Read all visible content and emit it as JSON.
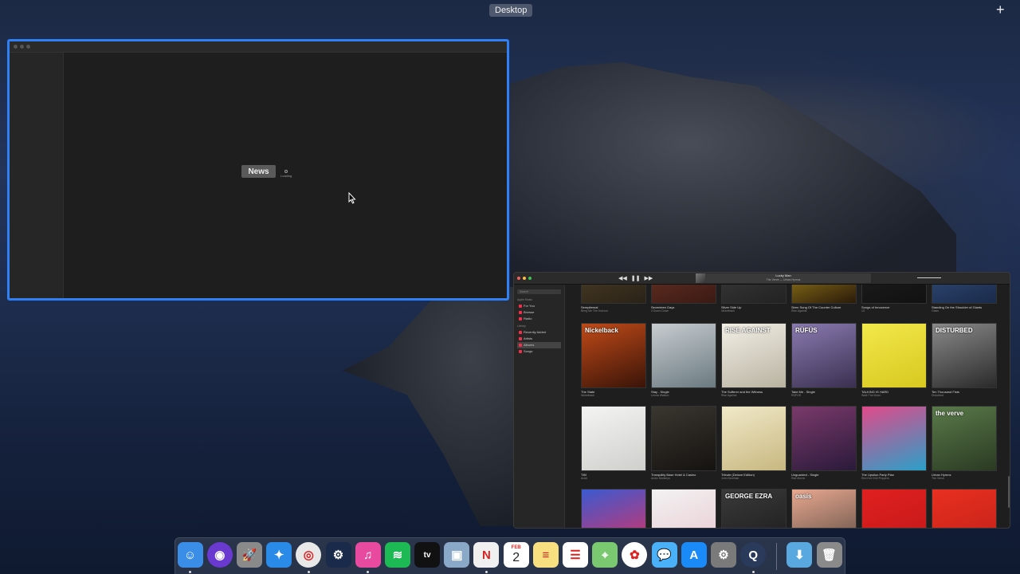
{
  "desktop": {
    "space_label": "Desktop",
    "add_space": "+"
  },
  "news_window": {
    "button_label": "News",
    "status": "Loading"
  },
  "music_window": {
    "now_playing": {
      "title": "Lucky Man",
      "subtitle": "The Verve — Urban Hymns"
    },
    "transport": {
      "prev": "◀◀",
      "play": "❚❚",
      "next": "▶▶"
    },
    "sidebar": {
      "search_placeholder": "Search",
      "section_apple_music": "Apple Music",
      "apple_music_items": [
        "For You",
        "Browse",
        "Radio"
      ],
      "section_library": "Library",
      "library_items": [
        "Recently Added",
        "Artists",
        "Albums",
        "Songs"
      ],
      "selected": "Albums"
    },
    "albums_row1": [
      {
        "title": "Sempiternal",
        "artist": "Bring Me The Horizon",
        "c1": "#5a4a2a",
        "c2": "#2a2218"
      },
      {
        "title": "Seventeen Days",
        "artist": "3 Doors Down",
        "c1": "#7a3a2a",
        "c2": "#3a1a14"
      },
      {
        "title": "Silver Side Up",
        "artist": "Nickelback",
        "c1": "#444444",
        "c2": "#222222"
      },
      {
        "title": "Siren Song Of The Counter Culture",
        "artist": "Rise Against",
        "c1": "#c9a820",
        "c2": "#2a1a0a"
      },
      {
        "title": "Songs of Innocence",
        "artist": "U2",
        "c1": "#222222",
        "c2": "#111111"
      },
      {
        "title": "Standing On the Shoulder of Giants",
        "artist": "Oasis",
        "c1": "#3a5a8a",
        "c2": "#1a2a4a"
      }
    ],
    "albums_row2": [
      {
        "title": "The State",
        "artist": "Nickelback",
        "c1": "#c04a18",
        "c2": "#3a1408",
        "label": "Nickelback"
      },
      {
        "title": "Stay - Single",
        "artist": "Leona Watson",
        "c1": "#c8ccd0",
        "c2": "#6a7a80",
        "label": ""
      },
      {
        "title": "The Sufferer and the Witness",
        "artist": "Rise Against",
        "c1": "#f2efe6",
        "c2": "#b8b2a0",
        "label": "RISE AGAINST"
      },
      {
        "title": "Take Me - Single",
        "artist": "RÜFÜS",
        "c1": "#8a7ab0",
        "c2": "#3a3050",
        "label": "RÜFÜS"
      },
      {
        "title": "TALKING IS HARD",
        "artist": "Walk The Moon",
        "c1": "#f2e84a",
        "c2": "#d8c820",
        "label": ""
      },
      {
        "title": "Ten Thousand Fists",
        "artist": "Disturbed",
        "c1": "#8a8a8a",
        "c2": "#2a2a2a",
        "label": "DISTURBED"
      }
    ],
    "albums_row3": [
      {
        "title": "TIM",
        "artist": "Avicii",
        "c1": "#f4f4f2",
        "c2": "#cfcfcc",
        "label": ""
      },
      {
        "title": "Tranquility Base Hotel & Casino",
        "artist": "Arctic Monkeys",
        "c1": "#3a3630",
        "c2": "#151310",
        "label": ""
      },
      {
        "title": "Tribute (Deluxe Edition)",
        "artist": "John Newman",
        "c1": "#f0e8c8",
        "c2": "#c8b880",
        "label": ""
      },
      {
        "title": "Unguarded - Single",
        "artist": "Rae Morris",
        "c1": "#7a3a6a",
        "c2": "#2a1a3a",
        "label": ""
      },
      {
        "title": "The Upsilon Party Plan",
        "artist": "Red Hot Chili Peppers",
        "c1": "#e04a8a",
        "c2": "#2aa0c8",
        "label": ""
      },
      {
        "title": "Urban Hymns",
        "artist": "The Verve",
        "c1": "#5a7a4a",
        "c2": "#2a3a22",
        "label": "the verve"
      }
    ],
    "albums_row4": [
      {
        "c1": "#3a5ad0",
        "c2": "#e03060",
        "label": ""
      },
      {
        "c1": "#f2f2f2",
        "c2": "#e8c8d0",
        "label": ""
      },
      {
        "c1": "#3a3a3a",
        "c2": "#1a1a1a",
        "label": "GEORGE EZRA"
      },
      {
        "c1": "#e8a890",
        "c2": "#5a4a40",
        "label": "oasis"
      },
      {
        "c1": "#e02020",
        "c2": "#c01818",
        "label": ""
      },
      {
        "c1": "#e83020",
        "c2": "#c02018",
        "label": ""
      }
    ]
  },
  "dock": {
    "items": [
      {
        "name": "finder",
        "glyph": "☺",
        "bg": "#3a8ee8",
        "running": true
      },
      {
        "name": "siri",
        "glyph": "◉",
        "bg": "#6a3ad0",
        "running": false
      },
      {
        "name": "launchpad",
        "glyph": "🚀",
        "bg": "#8a8a8a",
        "running": false
      },
      {
        "name": "safari",
        "glyph": "✦",
        "bg": "#2a8ae8",
        "running": false
      },
      {
        "name": "chrome",
        "glyph": "◎",
        "bg": "#e8e8e8",
        "running": true
      },
      {
        "name": "steam",
        "glyph": "⚙",
        "bg": "#1a2a4a",
        "running": false
      },
      {
        "name": "itunes",
        "glyph": "♫",
        "bg": "#e84aa0",
        "running": true
      },
      {
        "name": "spotify",
        "glyph": "≋",
        "bg": "#1db954",
        "running": false
      },
      {
        "name": "apple-tv",
        "glyph": "tv",
        "bg": "#111111",
        "running": false
      },
      {
        "name": "preview",
        "glyph": "▣",
        "bg": "#8aa8c8",
        "running": false
      },
      {
        "name": "news",
        "glyph": "N",
        "bg": "#f0f0f0",
        "running": true
      },
      {
        "name": "calendar",
        "glyph": "2",
        "bg": "#ffffff",
        "running": false
      },
      {
        "name": "notes",
        "glyph": "≡",
        "bg": "#f8e080",
        "running": false
      },
      {
        "name": "reminders",
        "glyph": "☰",
        "bg": "#ffffff",
        "running": false
      },
      {
        "name": "maps",
        "glyph": "⌖",
        "bg": "#7ac870",
        "running": false
      },
      {
        "name": "photos",
        "glyph": "✿",
        "bg": "#ffffff",
        "running": false
      },
      {
        "name": "messages",
        "glyph": "💬",
        "bg": "#4ab0f8",
        "running": false
      },
      {
        "name": "app-store",
        "glyph": "A",
        "bg": "#1a8af8",
        "running": false
      },
      {
        "name": "system-preferences",
        "glyph": "⚙",
        "bg": "#7a7a7a",
        "running": false
      },
      {
        "name": "quicktime",
        "glyph": "Q",
        "bg": "#2a3a5a",
        "running": true
      }
    ],
    "downloads": {
      "glyph": "⬇",
      "bg": "#5aa8e0"
    },
    "trash": {
      "glyph": "🗑",
      "bg": "#8a8a8a"
    },
    "calendar_month": "FEB",
    "calendar_day": "2"
  }
}
